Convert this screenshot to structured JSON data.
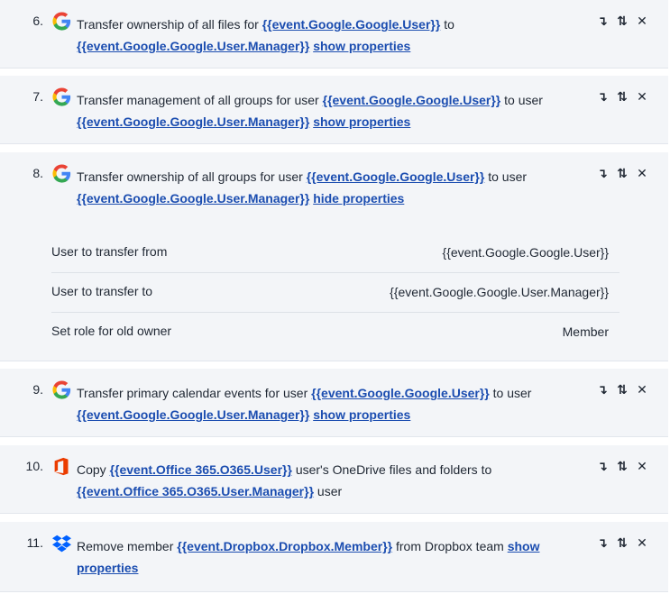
{
  "steps": [
    {
      "number": "6.",
      "icon": "google-icon",
      "text_before": "Transfer ownership of all files for",
      "var1": "{{event.Google.Google.User}}",
      "text_mid": "to",
      "var2": "{{event.Google.Google.User.Manager}}",
      "text_after": "",
      "toggle": "show properties"
    },
    {
      "number": "7.",
      "icon": "google-icon",
      "text_before": "Transfer management of all groups for user",
      "var1": "{{event.Google.Google.User}}",
      "text_mid": "to user",
      "var2": "{{event.Google.Google.User.Manager}}",
      "text_after": "",
      "toggle": "show properties"
    },
    {
      "number": "8.",
      "icon": "google-icon",
      "text_before": "Transfer ownership of all groups for user",
      "var1": "{{event.Google.Google.User}}",
      "text_mid": "to user",
      "var2": "{{event.Google.Google.User.Manager}}",
      "text_after": "",
      "toggle": "hide properties",
      "properties": [
        {
          "label": "User to transfer from",
          "value": "{{event.Google.Google.User}}"
        },
        {
          "label": "User to transfer to",
          "value": "{{event.Google.Google.User.Manager}}"
        },
        {
          "label": "Set role for old owner",
          "value": "Member"
        }
      ]
    },
    {
      "number": "9.",
      "icon": "google-icon",
      "text_before": "Transfer primary calendar events for user",
      "var1": "{{event.Google.Google.User}}",
      "text_mid": "to user",
      "var2": "{{event.Google.Google.User.Manager}}",
      "text_after": "",
      "toggle": "show properties"
    },
    {
      "number": "10.",
      "icon": "office-365-icon",
      "text_before": "Copy",
      "var1": "{{event.Office 365.O365.User}}",
      "text_mid": "user's OneDrive files and folders to",
      "var2": "{{event.Office 365.O365.User.Manager}}",
      "text_after": "user",
      "toggle": ""
    },
    {
      "number": "11.",
      "icon": "dropbox-icon",
      "text_before": "Remove member",
      "var1": "{{event.Dropbox.Dropbox.Member}}",
      "text_mid": "from Dropbox team",
      "var2": "",
      "text_after": "",
      "toggle": "show properties"
    }
  ],
  "actions": {
    "move_down": "↴",
    "move": "⇅",
    "remove": "✕"
  },
  "colors": {
    "link": "#1b4db0",
    "card_bg": "#f3f5f8"
  }
}
